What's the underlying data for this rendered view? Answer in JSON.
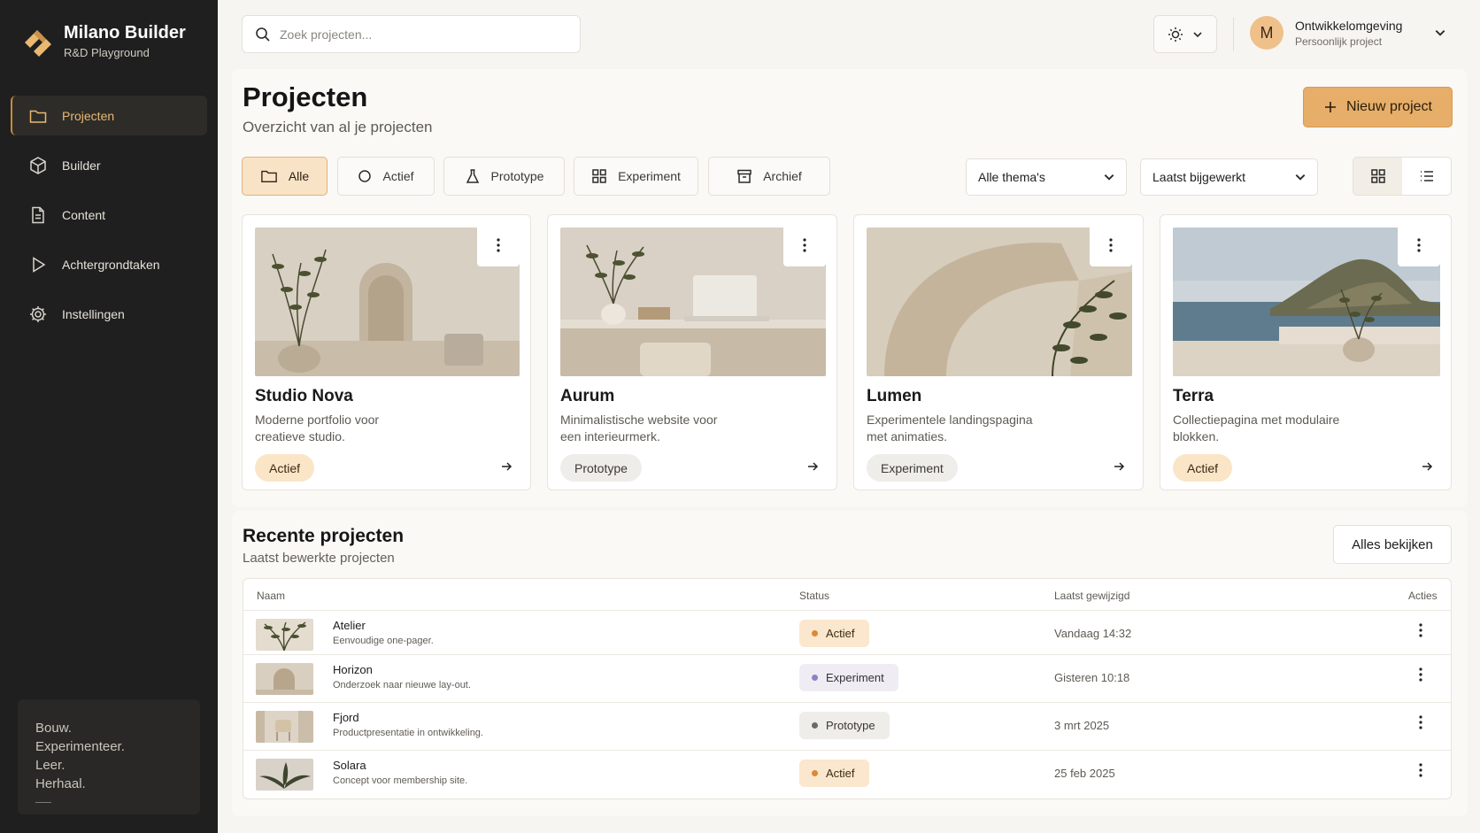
{
  "brand": {
    "title": "Milano Builder",
    "subtitle": "R&D Playground"
  },
  "sidebar": {
    "items": [
      {
        "label": "Projecten",
        "icon": "folder-icon",
        "active": true
      },
      {
        "label": "Builder",
        "icon": "cube-icon",
        "active": false
      },
      {
        "label": "Content",
        "icon": "document-icon",
        "active": false
      },
      {
        "label": "Achtergrondtaken",
        "icon": "play-icon",
        "active": false
      },
      {
        "label": "Instellingen",
        "icon": "gear-icon",
        "active": false
      }
    ],
    "tagline": [
      "Bouw.",
      "Experimenteer.",
      "Leer.",
      "Herhaal."
    ]
  },
  "topbar": {
    "search_placeholder": "Zoek projecten...",
    "user": {
      "initial": "M",
      "name": "Ontwikkelomgeving",
      "subtitle": "Persoonlijk project"
    }
  },
  "page": {
    "title": "Projecten",
    "subtitle": "Overzicht van al je projecten",
    "new_button": "Nieuw project"
  },
  "filters": [
    {
      "label": "Alle",
      "icon": "folder-icon",
      "active": true
    },
    {
      "label": "Actief",
      "icon": "circle-icon",
      "active": false
    },
    {
      "label": "Prototype",
      "icon": "flask-icon",
      "active": false
    },
    {
      "label": "Experiment",
      "icon": "grid-icon",
      "active": false
    },
    {
      "label": "Archief",
      "icon": "archive-icon",
      "active": false
    }
  ],
  "selects": {
    "theme": "Alle thema's",
    "sort": "Laatst bijgewerkt"
  },
  "view": {
    "active": "grid"
  },
  "cards": [
    {
      "title": "Studio Nova",
      "desc": "Moderne portfolio voor creatieve studio.",
      "badge": "Actief"
    },
    {
      "title": "Aurum",
      "desc": "Minimalistische website voor een interieurmerk.",
      "badge": "Prototype"
    },
    {
      "title": "Lumen",
      "desc": "Experimentele landingspagina met animaties.",
      "badge": "Experiment"
    },
    {
      "title": "Terra",
      "desc": "Collectiepagina met modulaire blokken.",
      "badge": "Actief"
    }
  ],
  "recent": {
    "title": "Recente projecten",
    "subtitle": "Laatst bewerkte projecten",
    "view_all": "Alles bekijken",
    "columns": [
      "Naam",
      "Status",
      "Laatst gewijzigd",
      "Acties"
    ],
    "rows": [
      {
        "name": "Atelier",
        "desc": "Eenvoudige one-pager.",
        "status": "Actief",
        "date": "Vandaag 14:32"
      },
      {
        "name": "Horizon",
        "desc": "Onderzoek naar nieuwe lay-out.",
        "status": "Experiment",
        "date": "Gisteren 10:18"
      },
      {
        "name": "Fjord",
        "desc": "Productpresentatie in ontwikkeling.",
        "status": "Prototype",
        "date": "3 mrt 2025"
      },
      {
        "name": "Solara",
        "desc": "Concept voor membership site.",
        "status": "Actief",
        "date": "25 feb 2025"
      }
    ]
  },
  "colors": {
    "accent": "#e6ae68",
    "sidebar_bg": "#1f1f1f",
    "active_nav_text": "#e9b871"
  }
}
